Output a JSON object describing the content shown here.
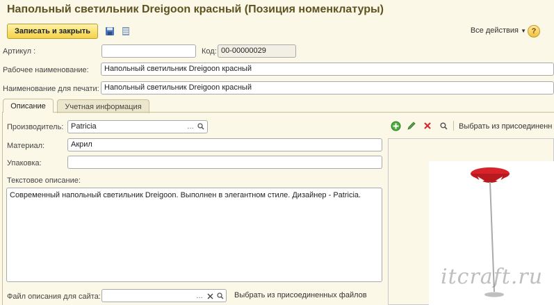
{
  "window": {
    "title": "Напольный светильник Dreigoon красный (Позиция номенклатуры)"
  },
  "toolbar": {
    "save_close_label": "Записать и закрыть",
    "all_actions_label": "Все действия",
    "help_label": "?"
  },
  "form": {
    "article_label": "Артикул :",
    "article_value": "",
    "code_label": "Код:",
    "code_value": "00-00000029",
    "work_name_label": "Рабочее наименование:",
    "work_name_value": "Напольный светильник Dreigoon красный",
    "print_name_label": "Наименование для печати:",
    "print_name_value": "Напольный светильник Dreigoon красный"
  },
  "tabs": [
    {
      "label": "Описание",
      "active": true
    },
    {
      "label": "Учетная информация",
      "active": false
    }
  ],
  "description": {
    "manufacturer_label": "Производитель:",
    "manufacturer_value": "Patricia",
    "material_label": "Материал:",
    "material_value": "Акрил",
    "packaging_label": "Упаковка:",
    "packaging_value": "",
    "text_label": "Текстовое описание:",
    "text_value": "Современный напольный светильник Dreigoon. Выполнен в элегантном стиле. Дизайнер - Patricia.",
    "site_file_label": "Файл описания для сайта:",
    "site_file_value": "",
    "choose_attached_bottom": "Выбрать из присоединенных файлов"
  },
  "image_panel": {
    "choose_attached_top": "Выбрать из присоединенн"
  },
  "watermark": "itcraft.ru",
  "colors": {
    "background": "#fbf8e8",
    "title": "#5e5220",
    "button_accent": "#f3d347",
    "lamp_red": "#d8232a"
  }
}
